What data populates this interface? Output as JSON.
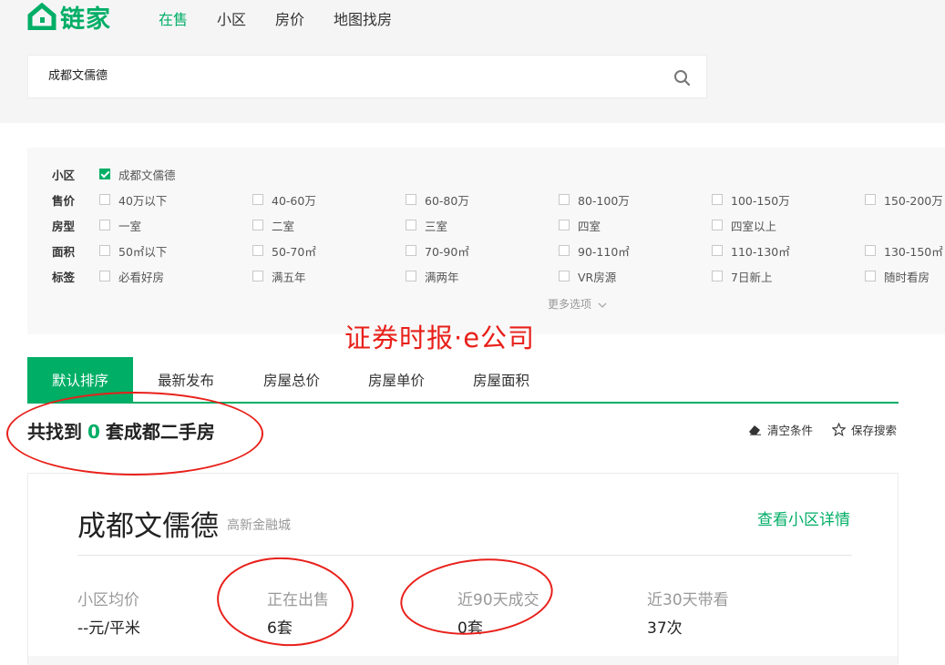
{
  "brand": {
    "name": "链家",
    "color": "#00ae66"
  },
  "nav": [
    {
      "label": "在售",
      "active": true
    },
    {
      "label": "小区",
      "active": false
    },
    {
      "label": "房价",
      "active": false
    },
    {
      "label": "地图找房",
      "active": false
    }
  ],
  "search": {
    "value": "成都文儒德",
    "icon": "search-icon"
  },
  "filters": {
    "community": {
      "label": "小区",
      "options": [
        "成都文儒德"
      ]
    },
    "price": {
      "label": "售价",
      "options": [
        "40万以下",
        "40-60万",
        "60-80万",
        "80-100万",
        "100-150万",
        "150-200万"
      ]
    },
    "layout": {
      "label": "房型",
      "options": [
        "一室",
        "二室",
        "三室",
        "四室",
        "四室以上"
      ]
    },
    "area": {
      "label": "面积",
      "options": [
        "50㎡以下",
        "50-70㎡",
        "70-90㎡",
        "90-110㎡",
        "110-130㎡",
        "130-150㎡"
      ]
    },
    "tags": {
      "label": "标签",
      "options": [
        "必看好房",
        "满五年",
        "满两年",
        "VR房源",
        "7日新上",
        "随时看房"
      ]
    },
    "more_label": "更多选项"
  },
  "watermark": "证券时报·e公司",
  "sort_tabs": [
    "默认排序",
    "最新发布",
    "房屋总价",
    "房屋单价",
    "房屋面积"
  ],
  "result": {
    "prefix": "共找到",
    "count": "0",
    "suffix": "套成都二手房"
  },
  "tools": {
    "clear_label": "清空条件",
    "save_label": "保存搜索"
  },
  "community_card": {
    "name": "成都文儒德",
    "district": "高新金融城",
    "detail_link": "查看小区详情",
    "stats": [
      {
        "label": "小区均价",
        "value": "--元/平米"
      },
      {
        "label": "正在出售",
        "value": "6套"
      },
      {
        "label": "近90天成交",
        "value": "0套"
      },
      {
        "label": "近30天带看",
        "value": "37次"
      }
    ]
  },
  "colors": {
    "accent": "#00ae66",
    "annotation_red": "#e8201a"
  }
}
